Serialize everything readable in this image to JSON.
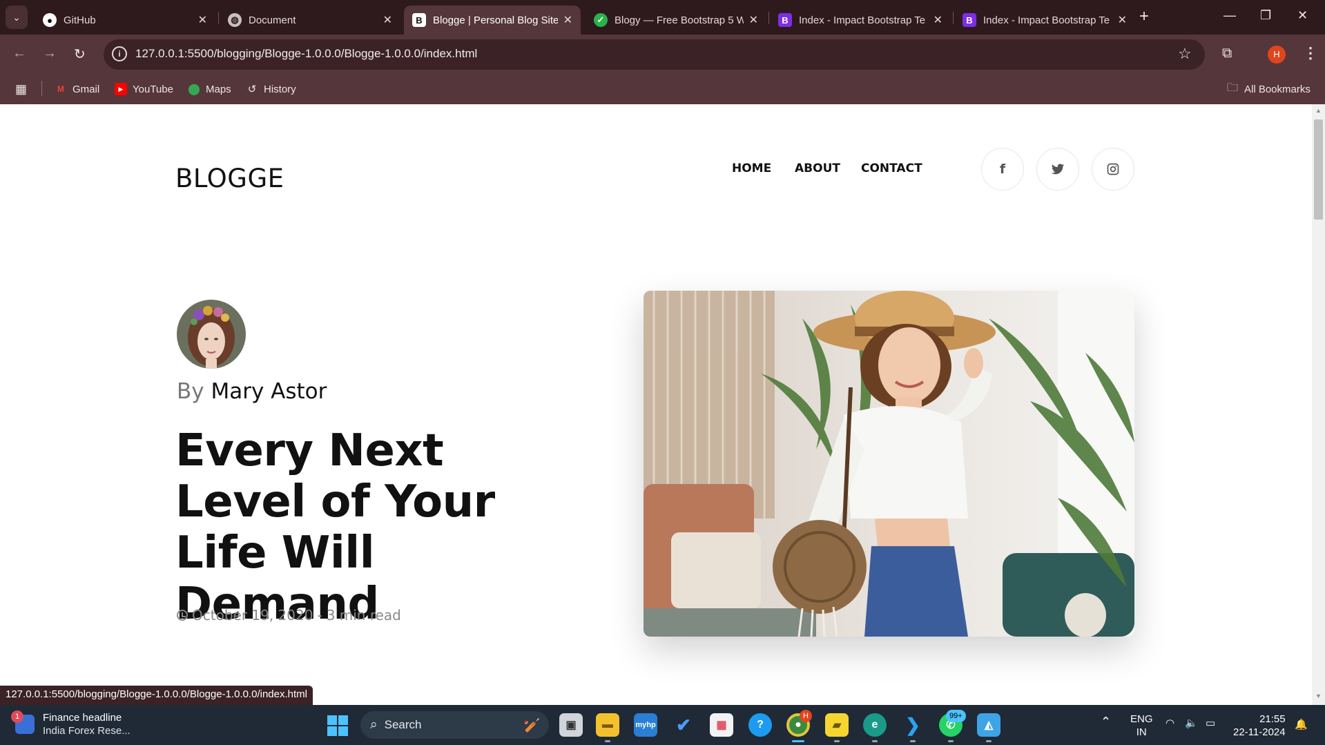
{
  "browser": {
    "tabs": [
      {
        "title": "GitHub",
        "active": false
      },
      {
        "title": "Document",
        "active": false
      },
      {
        "title": "Blogge | Personal Blog Site",
        "active": true
      },
      {
        "title": "Blogy — Free Bootstrap 5 W",
        "active": false
      },
      {
        "title": "Index - Impact Bootstrap Te",
        "active": false
      },
      {
        "title": "Index - Impact Bootstrap Te",
        "active": false
      }
    ],
    "url": "127.0.0.1:5500/blogging/Blogge-1.0.0.0/Blogge-1.0.0.0/index.html",
    "profile_initial": "H",
    "bookmarks": [
      "Gmail",
      "YouTube",
      "Maps",
      "History"
    ],
    "all_bookmarks": "All Bookmarks",
    "status_url": "127.0.0.1:5500/blogging/Blogge-1.0.0.0/Blogge-1.0.0.0/index.html"
  },
  "site": {
    "logo": "BLOGGE",
    "nav": [
      "HOME",
      "ABOUT",
      "CONTACT"
    ],
    "social": [
      "facebook-icon",
      "twitter-icon",
      "instagram-icon"
    ]
  },
  "post": {
    "by_prefix": "By",
    "author": "Mary Astor",
    "title": "Every Next Level of Your Life Will Demand",
    "date": "October 19, 2020",
    "separator": "-",
    "read_time": "3 min read"
  },
  "taskbar": {
    "widget_title": "Finance headline",
    "widget_subtitle": "India Forex Rese...",
    "widget_badge": "1",
    "search_placeholder": "Search",
    "chrome_badge": "H",
    "whatsapp_badge": "99+",
    "lang_line1": "ENG",
    "lang_line2": "IN",
    "time": "21:55",
    "date": "22-11-2024"
  },
  "colors": {
    "tabbar": "#2e1a1d",
    "toolbar": "#55363b",
    "taskbar": "#1f2a36",
    "accent": "#4cc2ff"
  }
}
